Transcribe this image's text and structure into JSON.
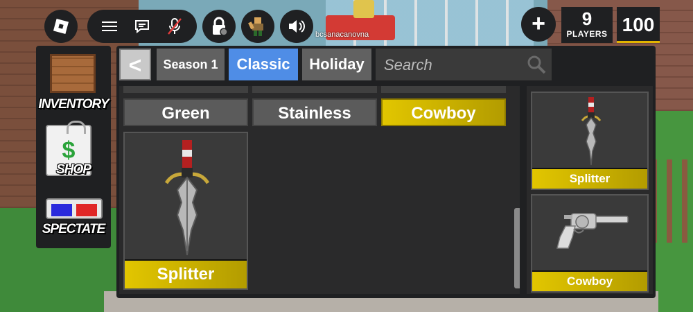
{
  "top_bar": {
    "icons": [
      "roblox-logo-icon",
      "hamburger-menu-icon",
      "chat-icon",
      "mic-muted-icon",
      "lock-icon",
      "avatar-emote-icon",
      "speaker-icon"
    ],
    "add_label": "+",
    "players": {
      "count": "9",
      "label": "PLAYERS"
    },
    "coins": "100"
  },
  "scene": {
    "player_name": "bcsanacanovna"
  },
  "left_menu": {
    "items": [
      {
        "label": "INVENTORY",
        "icon": "crate-icon"
      },
      {
        "label": "SHOP",
        "icon": "shopping-bag-icon",
        "glyph": "$"
      },
      {
        "label": "SPECTATE",
        "icon": "3d-glasses-icon"
      }
    ]
  },
  "panel": {
    "back_label": "<",
    "tabs": [
      "Season 1",
      "Classic",
      "Holiday"
    ],
    "active_tab": "Classic",
    "search": {
      "placeholder": "Search"
    },
    "skins": [
      "Green",
      "Stainless",
      "Cowboy"
    ],
    "selected_skin": "Cowboy",
    "item": {
      "name": "Splitter",
      "icon": "dagger-icon"
    },
    "equipped": [
      {
        "name": "Splitter",
        "icon": "dagger-icon"
      },
      {
        "name": "Cowboy",
        "icon": "revolver-icon"
      }
    ]
  },
  "colors": {
    "panel_bg": "#1f2022",
    "active_tab": "#4f8de6",
    "gold": "#e2c600",
    "inactive_tab": "#616161"
  }
}
